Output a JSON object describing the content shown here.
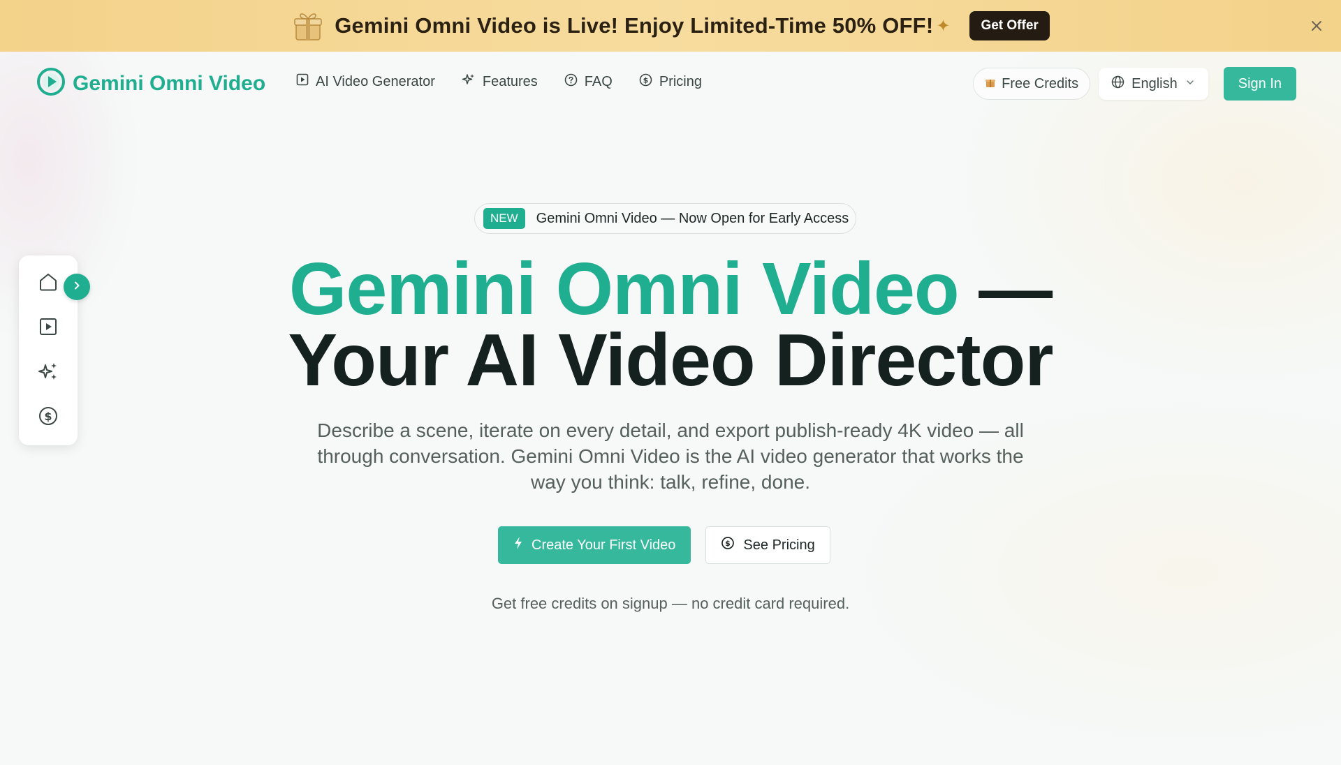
{
  "promo": {
    "text": "Gemini Omni Video is Live! Enjoy Limited-Time 50% OFF!",
    "cta": "Get Offer"
  },
  "nav": {
    "logo": "Gemini Omni Video",
    "links": [
      {
        "label": "AI Video Generator",
        "icon": "play-square-icon"
      },
      {
        "label": "Features",
        "icon": "sparkles-icon"
      },
      {
        "label": "FAQ",
        "icon": "question-circle-icon"
      },
      {
        "label": "Pricing",
        "icon": "dollar-circle-icon"
      }
    ],
    "free_credits": "Free Credits",
    "language": "English",
    "sign_in": "Sign In"
  },
  "rail": {
    "items": [
      "home-icon",
      "play-square-icon",
      "sparkles-icon",
      "dollar-circle-icon"
    ]
  },
  "hero": {
    "badge_new": "NEW",
    "badge_text": "Gemini Omni Video — Now Open for Early Access",
    "headline_accent": "Gemini Omni Video",
    "headline_dash": "—",
    "headline_line2": "Your AI Video Director",
    "subtitle": "Describe a scene, iterate on every detail, and export publish-ready 4K video — all through conversation. Gemini Omni Video is the AI video generator that works the way you think: talk, refine, done.",
    "cta_primary": "Create Your First Video",
    "cta_secondary": "See Pricing",
    "note": "Get free credits on signup — no credit card required."
  },
  "colors": {
    "brand": "#1fae8f",
    "button": "#35b89b",
    "promo_bg": "#f3d28a",
    "promo_button": "#241c12"
  }
}
